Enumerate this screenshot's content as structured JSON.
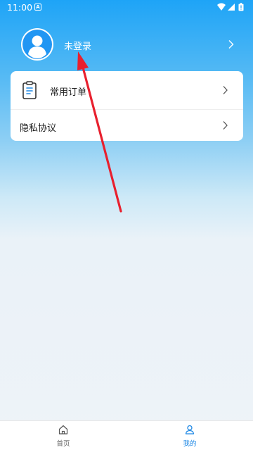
{
  "status_bar": {
    "time": "11:00",
    "notification_glyph": "A",
    "icons": [
      "wifi-icon",
      "signal-icon",
      "battery-icon"
    ]
  },
  "profile": {
    "username": "未登录",
    "avatar_icon": "user-avatar-icon"
  },
  "menu": {
    "items": [
      {
        "label": "常用订单",
        "icon": "clipboard-icon"
      },
      {
        "label": "隐私协议"
      }
    ]
  },
  "bottom_nav": {
    "items": [
      {
        "label": "首页",
        "icon": "home-icon",
        "active": false
      },
      {
        "label": "我的",
        "icon": "person-icon",
        "active": true
      }
    ]
  },
  "colors": {
    "header_gradient_top": "#1ea4f7",
    "page_background": "#eef3f8",
    "accent": "#1e88e5",
    "annotation_arrow": "#e8202e"
  }
}
